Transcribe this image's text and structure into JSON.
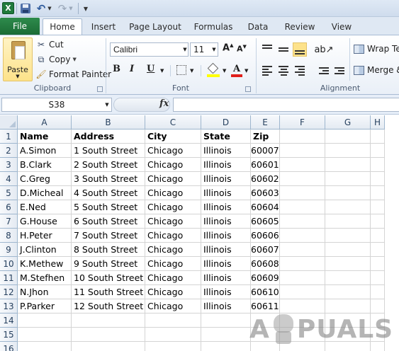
{
  "quick_access": {
    "app_icon": "X",
    "icons": [
      "excel-icon",
      "save-icon",
      "undo-icon",
      "redo-icon",
      "customize-qat-icon"
    ]
  },
  "tabs": [
    "File",
    "Home",
    "Insert",
    "Page Layout",
    "Formulas",
    "Data",
    "Review",
    "View"
  ],
  "active_tab": "Home",
  "ribbon": {
    "clipboard": {
      "paste": "Paste",
      "cut": "Cut",
      "copy": "Copy",
      "format_painter": "Format Painter",
      "group_label": "Clipboard"
    },
    "font": {
      "font_name": "Calibri",
      "font_size": "11",
      "grow": "A",
      "shrink": "A",
      "bold": "B",
      "italic": "I",
      "underline": "U",
      "font_color_glyph": "A",
      "group_label": "Font",
      "fill_color": "#ffff00",
      "font_color": "#e0201b"
    },
    "alignment": {
      "wrap_text": "Wrap Tex",
      "merge": "Merge &",
      "group_label": "Alignment"
    }
  },
  "formula_bar": {
    "name_box": "S38",
    "fx": "fx",
    "formula": ""
  },
  "grid": {
    "columns": [
      "A",
      "B",
      "C",
      "D",
      "E",
      "F",
      "G",
      "H"
    ],
    "row_numbers": [
      "1",
      "2",
      "3",
      "4",
      "5",
      "6",
      "7",
      "8",
      "9",
      "10",
      "11",
      "12",
      "13",
      "14",
      "15",
      "16"
    ],
    "headers": [
      "Name",
      "Address",
      "City",
      "State",
      "Zip"
    ],
    "rows": [
      [
        "A.Simon",
        "1 South Street",
        "Chicago",
        "Illinois",
        "60007"
      ],
      [
        "B.Clark",
        "2 South Street",
        "Chicago",
        "Illinois",
        "60601"
      ],
      [
        "C.Greg",
        "3 South Street",
        "Chicago",
        "Illinois",
        "60602"
      ],
      [
        "D.Micheal",
        "4 South Street",
        "Chicago",
        "Illinois",
        "60603"
      ],
      [
        "E.Ned",
        "5 South Street",
        "Chicago",
        "Illinois",
        "60604"
      ],
      [
        "G.House",
        "6 South Street",
        "Chicago",
        "Illinois",
        "60605"
      ],
      [
        "H.Peter",
        "7 South Street",
        "Chicago",
        "Illinois",
        "60606"
      ],
      [
        "J.Clinton",
        "8 South Street",
        "Chicago",
        "Illinois",
        "60607"
      ],
      [
        "K.Methew",
        "9 South Street",
        "Chicago",
        "Illinois",
        "60608"
      ],
      [
        "M.Stefhen",
        "10 South Street",
        "Chicago",
        "Illinois",
        "60609"
      ],
      [
        "N.Jhon",
        "11 South Street",
        "Chicago",
        "Illinois",
        "60610"
      ],
      [
        "P.Parker",
        "12 South Street",
        "Chicago",
        "Illinois",
        "60611"
      ]
    ]
  },
  "watermark": {
    "left": "A",
    "right": "PUALS"
  },
  "colors": {
    "file_tab": "#1f7a3c",
    "header_text": "#27415f",
    "grid_line": "#d4d4d4"
  }
}
